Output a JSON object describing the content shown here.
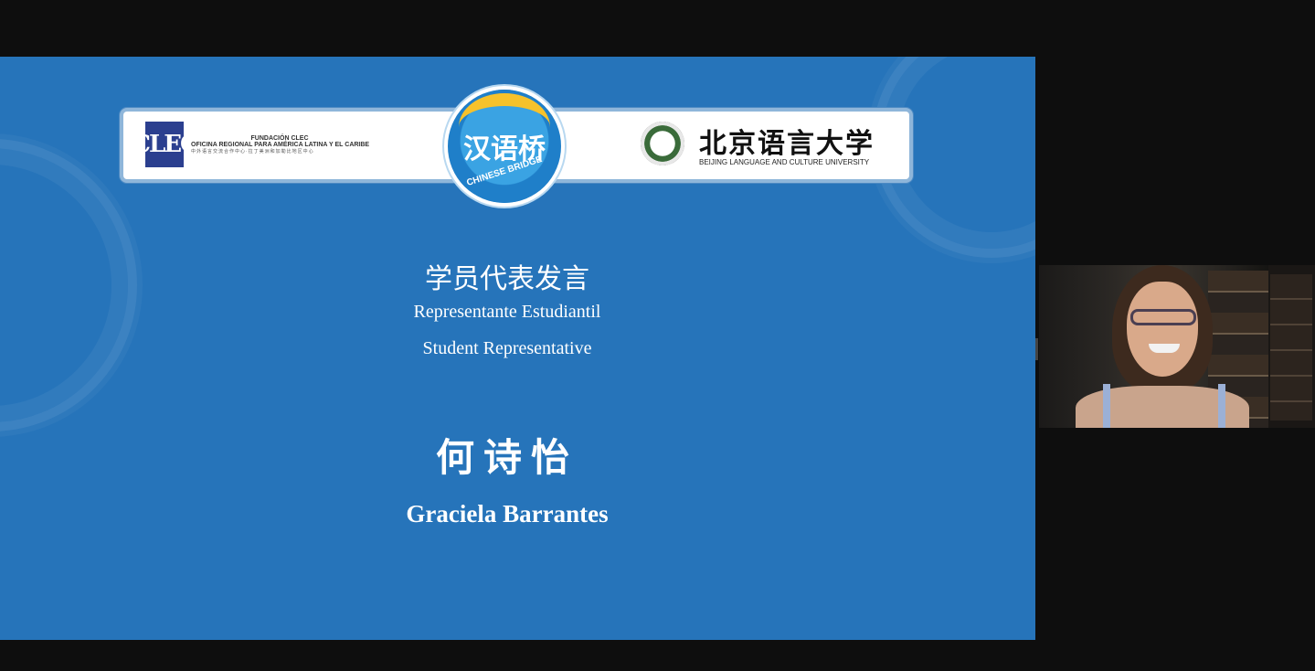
{
  "slide": {
    "banner": {
      "clec": {
        "logo_text": "CLEC",
        "line1": "FUNDACIÓN CLEC",
        "line2": "OFICINA REGIONAL PARA AMÉRICA LATINA Y EL CARIBE",
        "line3": "中外语言交流合作中心·拉丁美洲和加勒比地区中心"
      },
      "chinese_bridge": {
        "cn": "汉语桥",
        "en": "CHINESE BRIDGE"
      },
      "blcu": {
        "cn": "北京语言大学",
        "en": "BEIJING LANGUAGE AND CULTURE UNIVERSITY"
      }
    },
    "title_cn": "学员代表发言",
    "title_es": "Representante Estudiantil",
    "title_en": "Student Representative",
    "name_cn": "何诗怡",
    "name_en": "Graciela Barrantes"
  },
  "colors": {
    "slide_bg": "#2674ba",
    "stage_bg": "#0e0e0e",
    "badge_yellow": "#f6c22b",
    "clec_blue": "#2b3f8f"
  }
}
